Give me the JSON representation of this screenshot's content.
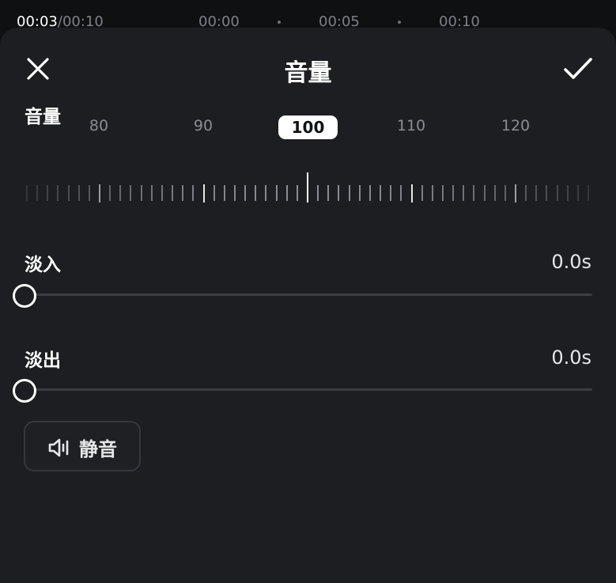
{
  "timeline": {
    "current": "00:03",
    "total": "/00:10",
    "marks": [
      "00:00",
      "00:05",
      "00:10"
    ]
  },
  "sheet": {
    "title": "音量",
    "close_icon": "close-icon",
    "confirm_icon": "check-icon"
  },
  "volume": {
    "label": "音量",
    "ruler_labels": [
      "80",
      "90",
      "110",
      "120"
    ],
    "value": "100"
  },
  "fade_in": {
    "label": "淡入",
    "value": "0.0s",
    "level": 0
  },
  "fade_out": {
    "label": "淡出",
    "value": "0.0s",
    "level": 0
  },
  "mute": {
    "label": "静音",
    "icon": "speaker-mute-icon"
  },
  "colors": {
    "background": "#0f1012",
    "sheet": "#1c1e21",
    "text": "#ffffff",
    "muted_text": "#8a8d92",
    "track": "#3a3d42"
  }
}
